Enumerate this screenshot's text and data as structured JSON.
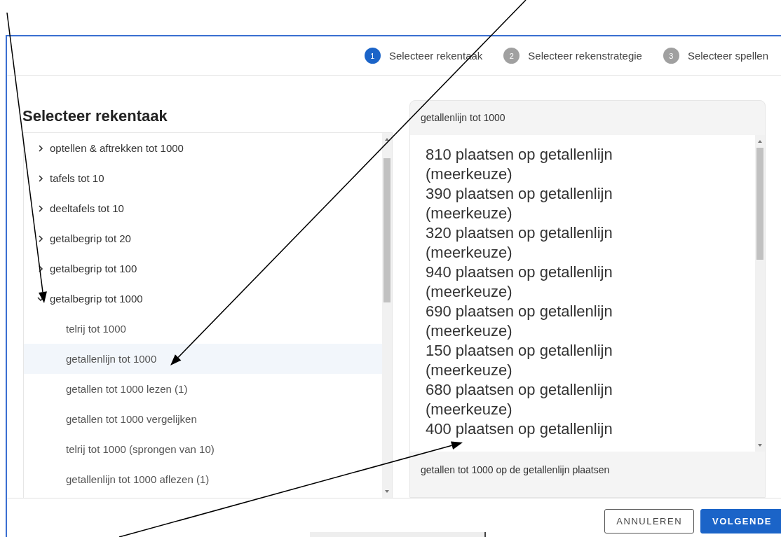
{
  "steps": [
    {
      "number": "1",
      "label": "Selecteer rekentaak",
      "selected": true
    },
    {
      "number": "2",
      "label": "Selecteer rekenstrategie",
      "selected": false
    },
    {
      "number": "3",
      "label": "Selecteer spellen",
      "selected": false
    }
  ],
  "heading": "Selecteer rekentaak",
  "tree": [
    {
      "label": "optellen & aftrekken tot 1000",
      "expanded": false
    },
    {
      "label": "tafels tot 10",
      "expanded": false
    },
    {
      "label": "deeltafels tot 10",
      "expanded": false
    },
    {
      "label": "getalbegrip tot 20",
      "expanded": false
    },
    {
      "label": "getalbegrip tot 100",
      "expanded": false
    },
    {
      "label": "getalbegrip tot 1000",
      "expanded": true,
      "children": [
        {
          "label": "telrij tot 1000",
          "selected": false
        },
        {
          "label": "getallenlijn tot 1000",
          "selected": true
        },
        {
          "label": "getallen tot 1000 lezen (1)",
          "selected": false
        },
        {
          "label": "getallen tot 1000 vergelijken",
          "selected": false
        },
        {
          "label": "telrij tot 1000 (sprongen van 10)",
          "selected": false
        },
        {
          "label": "getallenlijn tot 1000 aflezen (1)",
          "selected": false
        }
      ]
    }
  ],
  "detail": {
    "title": "getallenlijn tot 1000",
    "items": [
      "810 plaatsen op getallenlijn (meerkeuze)",
      "390 plaatsen op getallenlijn (meerkeuze)",
      "320 plaatsen op getallenlijn (meerkeuze)",
      "940 plaatsen op getallenlijn (meerkeuze)",
      "690 plaatsen op getallenlijn (meerkeuze)",
      "150 plaatsen op getallenlijn (meerkeuze)",
      "680 plaatsen op getallenlijn (meerkeuze)",
      "400 plaatsen op getallenlijn"
    ],
    "description": "getallen tot 1000 op de getallenlijn plaatsen"
  },
  "buttons": [
    {
      "label": "ANNULEREN",
      "kind": "secondary"
    },
    {
      "label": "VOLGENDE",
      "kind": "primary"
    }
  ]
}
